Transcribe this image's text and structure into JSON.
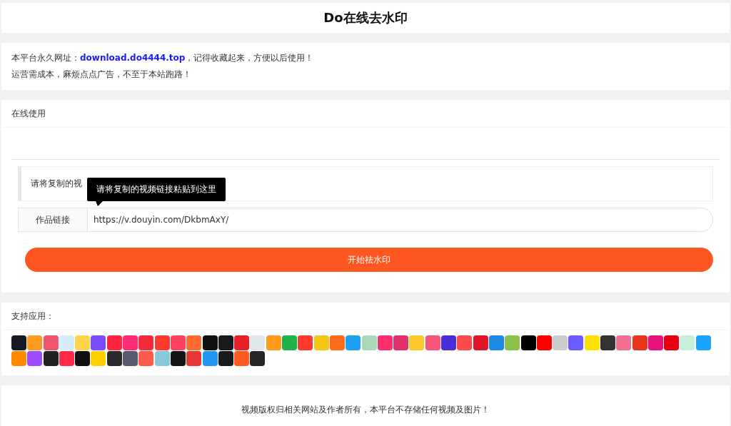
{
  "header": {
    "title": "Do在线去水印"
  },
  "notice": {
    "line_1": {
      "before": "本平台永久网址：",
      "link": "download.do4444.top",
      "after": "，记得收藏起来，方便以后使用！"
    },
    "line_2": "运营需成本，麻烦点点广告，不至于本站跑路！"
  },
  "tool": {
    "heading": "在线使用",
    "quote": "请将复制的视",
    "tooltip": "请将复制的视频链接粘贴到这里",
    "field_label": "作品链接",
    "field_value": "https://v.douyin.com/DkbmAxY/",
    "button": "开始祛水印"
  },
  "apps": {
    "heading": "支持应用：",
    "icons": [
      {
        "color": "#161823"
      },
      {
        "color": "#ff9a1f"
      },
      {
        "color": "#f2546e"
      },
      {
        "color": "#d6ecf8"
      },
      {
        "color": "#ffd34d"
      },
      {
        "color": "#7b4dff"
      },
      {
        "color": "#ff2442"
      },
      {
        "color": "#ff2b74"
      },
      {
        "color": "#f22a3c"
      },
      {
        "color": "#ff3b2f"
      },
      {
        "color": "#ff4060"
      },
      {
        "color": "#ff6a2f"
      },
      {
        "color": "#111111"
      },
      {
        "color": "#1a1a1a"
      },
      {
        "color": "#e8202a"
      },
      {
        "color": "#dfe8ea"
      },
      {
        "color": "#ff9a1a"
      },
      {
        "color": "#21b24b"
      },
      {
        "color": "#ff3a2a"
      },
      {
        "color": "#f5c518"
      },
      {
        "color": "#ff6b1a"
      },
      {
        "color": "#1da1f2"
      },
      {
        "color": "#a8d8b9"
      },
      {
        "color": "#ff2d6a"
      },
      {
        "color": "#e1306c"
      },
      {
        "color": "#ffc72c"
      },
      {
        "color": "#f5557a"
      },
      {
        "color": "#4a2fd8"
      },
      {
        "color": "#ff4a4a"
      },
      {
        "color": "#e0162b"
      },
      {
        "color": "#1e88e5"
      },
      {
        "color": "#8bc34a"
      },
      {
        "color": "#000000"
      },
      {
        "color": "#ff0000"
      },
      {
        "color": "#cccccc"
      },
      {
        "color": "#6a5cff"
      },
      {
        "color": "#ffe000"
      },
      {
        "color": "#333333"
      },
      {
        "color": "#f07090"
      },
      {
        "color": "#e8361e"
      },
      {
        "color": "#e6137c"
      },
      {
        "color": "#e60012"
      },
      {
        "color": "#c8eedb"
      },
      {
        "color": "#1aa3ff"
      },
      {
        "color": "#ff8a00"
      },
      {
        "color": "#9c4dff"
      },
      {
        "color": "#222222"
      },
      {
        "color": "#ff2a46"
      },
      {
        "color": "#111111"
      },
      {
        "color": "#ffd200"
      },
      {
        "color": "#2a2a2a"
      },
      {
        "color": "#5a5a6e"
      },
      {
        "color": "#ff5a4a"
      },
      {
        "color": "#88c8d8"
      },
      {
        "color": "#151515"
      },
      {
        "color": "#e53935"
      },
      {
        "color": "#2196f3"
      },
      {
        "color": "#1a1a1a"
      },
      {
        "color": "#ff5a1f"
      },
      {
        "color": "#262626"
      }
    ]
  },
  "footer": {
    "text": "视频版权归相关网站及作者所有，本平台不存储任何视频及图片！"
  }
}
